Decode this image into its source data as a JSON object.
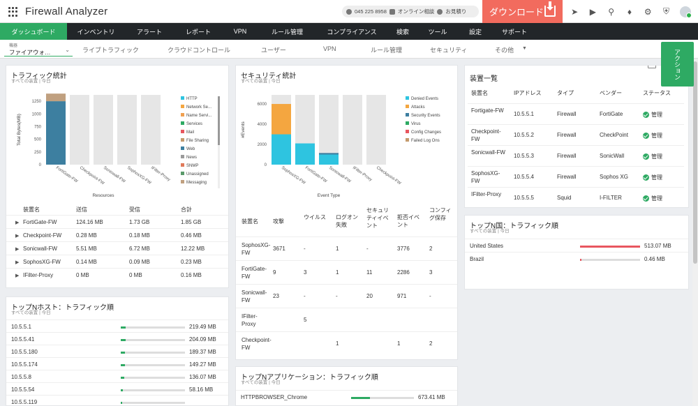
{
  "app": {
    "title": "Firewall Analyzer"
  },
  "header": {
    "phone": "045 225 8958",
    "online_consult": "オンライン相談",
    "estimate": "お見積り",
    "download_label": "ダウンロード",
    "icons": [
      "rocket-icon",
      "video-icon",
      "search-icon",
      "bell-icon",
      "gear-icon",
      "shield-icon",
      "avatar"
    ]
  },
  "mainnav": [
    "ダッシュボード",
    "インベントリ",
    "アラート",
    "レポート",
    "VPN",
    "ルール管理",
    "コンプライアンス",
    "検索",
    "ツール",
    "設定",
    "サポート"
  ],
  "subnav": {
    "device_label": "機器",
    "device_value": "ファイアウォ…",
    "tabs": [
      "ライブトラフィック",
      "クラウドコントロール",
      "ユーザー",
      "VPN",
      "ルール管理",
      "セキュリティ",
      "その他"
    ],
    "action_label": "アクション"
  },
  "colors": {
    "accent": "#2eaa63",
    "download": "#f26b5e",
    "nav_bg": "#222629",
    "red_bar": "#e8565f"
  },
  "traffic": {
    "title": "トラフィック統計",
    "subtitle": "すべての装置 | 今日",
    "chart_data": {
      "type": "bar",
      "ylabel": "Total Bytes(MB)",
      "xlabel": "Resources",
      "yticks": [
        0,
        250,
        500,
        750,
        1000,
        1250
      ],
      "categories": [
        "FortiGate-FW",
        "Checkpoint-FW",
        "Sonicwall-FW",
        "SophosXG-FW",
        "IFilter-Proxy"
      ],
      "series": [
        {
          "name": "HTTP",
          "color": "#2ec4e0",
          "values": [
            0,
            0,
            0,
            0,
            0
          ]
        },
        {
          "name": "Network Se...",
          "color": "#f4a640",
          "values": [
            0,
            0,
            0,
            0,
            0
          ]
        },
        {
          "name": "Name Servi...",
          "color": "#f0a050",
          "values": [
            0,
            0,
            0,
            0,
            0
          ]
        },
        {
          "name": "Services",
          "color": "#2eaa63",
          "values": [
            0,
            0,
            0,
            0,
            0
          ]
        },
        {
          "name": "Mail",
          "color": "#e8565f",
          "values": [
            0,
            0,
            0,
            0,
            0
          ]
        },
        {
          "name": "File Sharing",
          "color": "#c49a6c",
          "values": [
            0,
            0,
            0,
            0,
            0
          ]
        },
        {
          "name": "Web",
          "color": "#3d7fa0",
          "values": [
            1250,
            0,
            0,
            0,
            0
          ]
        },
        {
          "name": "News",
          "color": "#9a9a9a",
          "values": [
            0,
            0,
            0,
            0,
            0
          ]
        },
        {
          "name": "SNMP",
          "color": "#e07a5a",
          "values": [
            0,
            0,
            0,
            0,
            0
          ]
        },
        {
          "name": "Unassigned",
          "color": "#5a9a6a",
          "values": [
            0,
            0,
            0,
            0,
            0
          ]
        },
        {
          "name": "Messaging",
          "color": "#c0a080",
          "values": [
            150,
            0,
            0,
            0,
            0
          ]
        }
      ]
    },
    "table": {
      "headers": [
        "装置名",
        "送信",
        "受信",
        "合計"
      ],
      "rows": [
        [
          "FortiGate-FW",
          "124.16 MB",
          "1.73 GB",
          "1.85 GB"
        ],
        [
          "Checkpoint-FW",
          "0.28 MB",
          "0.18 MB",
          "0.46 MB"
        ],
        [
          "Sonicwall-FW",
          "5.51 MB",
          "6.72 MB",
          "12.22 MB"
        ],
        [
          "SophosXG-FW",
          "0.14 MB",
          "0.09 MB",
          "0.23 MB"
        ],
        [
          "IFilter-Proxy",
          "0 MB",
          "0 MB",
          "0.16 MB"
        ]
      ]
    }
  },
  "security": {
    "title": "セキュリティ統計",
    "subtitle": "すべての装置 | 今日",
    "chart_data": {
      "type": "bar",
      "ylabel": "#Events",
      "xlabel": "Event Type",
      "yticks": [
        0,
        2000,
        4000,
        6000
      ],
      "categories": [
        "SophosXG-FW",
        "FortiGate-FW",
        "Sonicwall-FW",
        "IFilter-Proxy",
        "Checkpoint-FW"
      ],
      "series": [
        {
          "name": "Denied Events",
          "color": "#2ec4e0",
          "values": [
            3000,
            2100,
            1000,
            0,
            0
          ]
        },
        {
          "name": "Attacks",
          "color": "#f4a640",
          "values": [
            3000,
            0,
            0,
            0,
            0
          ]
        },
        {
          "name": "Security Events",
          "color": "#3d7fa0",
          "values": [
            0,
            0,
            150,
            0,
            0
          ]
        },
        {
          "name": "Virus",
          "color": "#2eaa63",
          "values": [
            0,
            0,
            0,
            0,
            0
          ]
        },
        {
          "name": "Config Changes",
          "color": "#e8565f",
          "values": [
            0,
            0,
            0,
            0,
            0
          ]
        },
        {
          "name": "Failed Log Ons",
          "color": "#c49a6c",
          "values": [
            0,
            0,
            0,
            0,
            0
          ]
        }
      ]
    },
    "table": {
      "headers": [
        "装置名",
        "攻撃",
        "ウイルス",
        "ログオン失敗",
        "セキュリティイベント",
        "拒否イベント",
        "コンフィグ保存"
      ],
      "rows": [
        [
          "SophosXG-FW",
          "3671",
          "-",
          "1",
          "-",
          "3776",
          "2"
        ],
        [
          "FortiGate-FW",
          "9",
          "3",
          "1",
          "11",
          "2286",
          "3"
        ],
        [
          "Sonicwall-FW",
          "23",
          "-",
          "-",
          "20",
          "971",
          "-"
        ],
        [
          "IFilter-Proxy",
          "",
          "5",
          "",
          "",
          "",
          ""
        ],
        [
          "Checkpoint-FW",
          "",
          "",
          "1",
          "",
          "1",
          "2"
        ]
      ]
    }
  },
  "devices": {
    "title": "装置一覧",
    "headers": [
      "装置名",
      "IPアドレス",
      "タイプ",
      "ベンダー",
      "ステータス"
    ],
    "rows": [
      [
        "Fortigate-FW",
        "10.5.5.1",
        "Firewall",
        "FortiGate",
        "管理"
      ],
      [
        "Checkpoint-FW",
        "10.5.5.2",
        "Firewall",
        "CheckPoint",
        "管理"
      ],
      [
        "Sonicwall-FW",
        "10.5.5.3",
        "Firewall",
        "SonicWall",
        "管理"
      ],
      [
        "SophosXG-FW",
        "10.5.5.4",
        "Firewall",
        "Sophos XG",
        "管理"
      ],
      [
        "IFilter-Proxy",
        "10.5.5.5",
        "Squid",
        "I-FILTER",
        "管理"
      ]
    ]
  },
  "top_hosts": {
    "title": "トップNホスト：トラフィック順",
    "subtitle": "すべての装置 | 今日",
    "rows": [
      {
        "name": "10.5.5.1",
        "value": "219.49 MB",
        "fraction": 0.08
      },
      {
        "name": "10.5.5.41",
        "value": "204.09 MB",
        "fraction": 0.08
      },
      {
        "name": "10.5.5.180",
        "value": "189.37 MB",
        "fraction": 0.07
      },
      {
        "name": "10.5.5.174",
        "value": "149.27 MB",
        "fraction": 0.06
      },
      {
        "name": "10.5.5.8",
        "value": "136.07 MB",
        "fraction": 0.05
      },
      {
        "name": "10.5.5.54",
        "value": "58.16 MB",
        "fraction": 0.03
      },
      {
        "name": "10.5.5.119",
        "value": "",
        "fraction": 0.02
      }
    ]
  },
  "top_countries": {
    "title": "トップN国：トラフィック順",
    "subtitle": "すべての装置 | 今日",
    "rows": [
      {
        "name": "United States",
        "value": "513.07 MB",
        "fraction": 1.0
      },
      {
        "name": "Brazil",
        "value": "0.46 MB",
        "fraction": 0.0
      }
    ]
  },
  "top_apps": {
    "title": "トップNアプリケーション：トラフィック順",
    "subtitle": "すべての装置 | 今日",
    "rows": [
      {
        "name": "HTTPBROWSER_Chrome",
        "value": "673.41 MB",
        "fraction": 0.3
      }
    ]
  }
}
